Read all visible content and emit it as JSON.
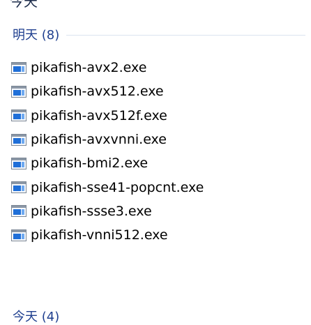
{
  "top_partial_header": "今天",
  "group": {
    "title": "明天 (8)"
  },
  "files": [
    {
      "name": "pikafish-avx2.exe",
      "icon": "exe-icon"
    },
    {
      "name": "pikafish-avx512.exe",
      "icon": "exe-icon"
    },
    {
      "name": "pikafish-avx512f.exe",
      "icon": "exe-icon"
    },
    {
      "name": "pikafish-avxvnni.exe",
      "icon": "exe-icon"
    },
    {
      "name": "pikafish-bmi2.exe",
      "icon": "exe-icon"
    },
    {
      "name": "pikafish-sse41-popcnt.exe",
      "icon": "exe-icon"
    },
    {
      "name": "pikafish-ssse3.exe",
      "icon": "exe-icon"
    },
    {
      "name": "pikafish-vnni512.exe",
      "icon": "exe-icon"
    }
  ],
  "next_group": {
    "title": "今天 (4)"
  },
  "colors": {
    "header_text": "#1f3f8f",
    "divider": "#dbe4ef",
    "icon_frame": "#7a8694",
    "icon_blue": "#1f6fd8"
  }
}
